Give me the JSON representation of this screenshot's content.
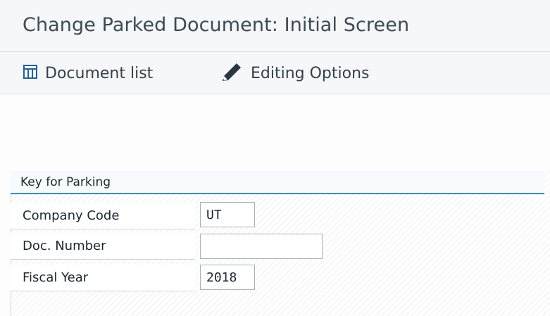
{
  "window": {
    "title": "Change Parked Document: Initial Screen"
  },
  "toolbar": {
    "document_list": {
      "label": "Document list",
      "icon": "table-grid-icon"
    },
    "editing_options": {
      "label": "Editing Options",
      "icon": "pencil-icon"
    }
  },
  "key_for_parking": {
    "title": "Key for Parking",
    "company_code": {
      "label": "Company Code",
      "value": "UT"
    },
    "doc_number": {
      "label": "Doc. Number",
      "value": ""
    },
    "fiscal_year": {
      "label": "Fiscal Year",
      "value": "2018"
    }
  },
  "colors": {
    "accent": "#2a8fd0",
    "icon_blue": "#1f5fa8",
    "text": "#1b2630"
  }
}
